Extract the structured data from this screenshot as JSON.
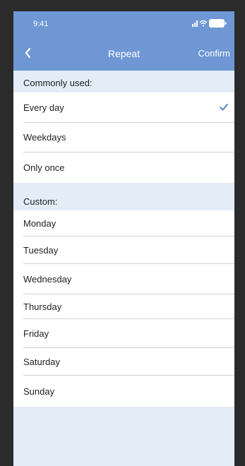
{
  "status_bar": {
    "time": "9:41"
  },
  "nav": {
    "title": "Repeat",
    "confirm_label": "Confirm"
  },
  "common": {
    "section_label": "Commonly used:",
    "items": [
      {
        "label": "Every day",
        "selected": true
      },
      {
        "label": "Weekdays",
        "selected": false
      },
      {
        "label": "Only once",
        "selected": false
      }
    ]
  },
  "custom": {
    "section_label": "Custom:",
    "items": [
      {
        "label": "Monday"
      },
      {
        "label": "Tuesday"
      },
      {
        "label": "Wednesday"
      },
      {
        "label": "Thursday"
      },
      {
        "label": "Friday"
      },
      {
        "label": "Saturday"
      },
      {
        "label": "Sunday"
      }
    ]
  },
  "colors": {
    "accent": "#6e97d4",
    "check": "#4a78c8",
    "background": "#e3edf8"
  }
}
